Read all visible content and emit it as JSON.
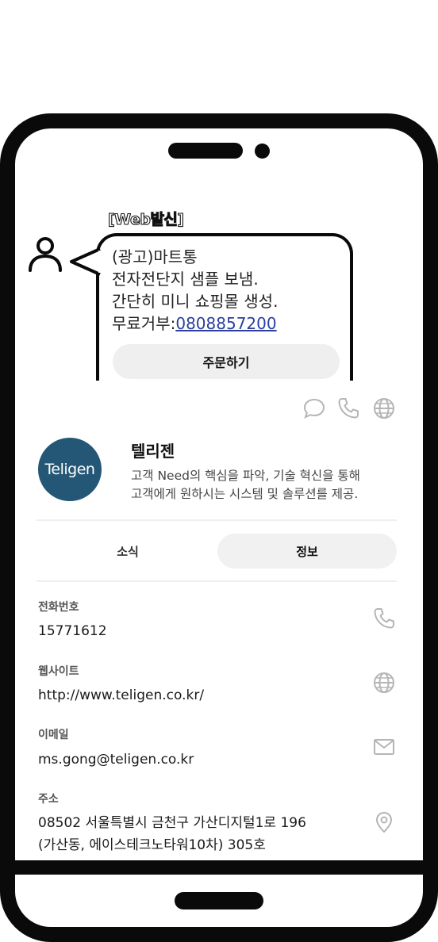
{
  "message": {
    "sender_tag": "[Web발신]",
    "line1": "(광고)마트통",
    "line2": "전자전단지 샘플 보냄.",
    "line3": "간단히 미니 쇼핑몰 생성.",
    "optout_prefix": "무료거부:",
    "optout_number": "0808857200",
    "order_button": "주문하기"
  },
  "actions": [
    "chat-icon",
    "phone-icon",
    "globe-icon"
  ],
  "profile": {
    "logo_text": "Teligen",
    "name": "텔리젠",
    "description": "고객 Need의 핵심을 파악, 기술 혁신을 통해\n고객에게 원하시는 시스템 및 솔루션를 제공."
  },
  "tabs": [
    {
      "label": "소식",
      "active": false
    },
    {
      "label": "정보",
      "active": true
    }
  ],
  "info": {
    "phone": {
      "label": "전화번호",
      "value": "15771612"
    },
    "website": {
      "label": "웹사이트",
      "value": "http://www.teligen.co.kr/"
    },
    "email": {
      "label": "이메일",
      "value": "ms.gong@teligen.co.kr"
    },
    "address": {
      "label": "주소",
      "line1": "08502 서울특별시 금천구 가산디지털1로 196",
      "line2": "(가산동, 에이스테크노타워10차) 305호"
    }
  },
  "colors": {
    "logo_bg": "#245776",
    "link": "#2a3fa0",
    "icon_gray": "#b5b5b5"
  }
}
